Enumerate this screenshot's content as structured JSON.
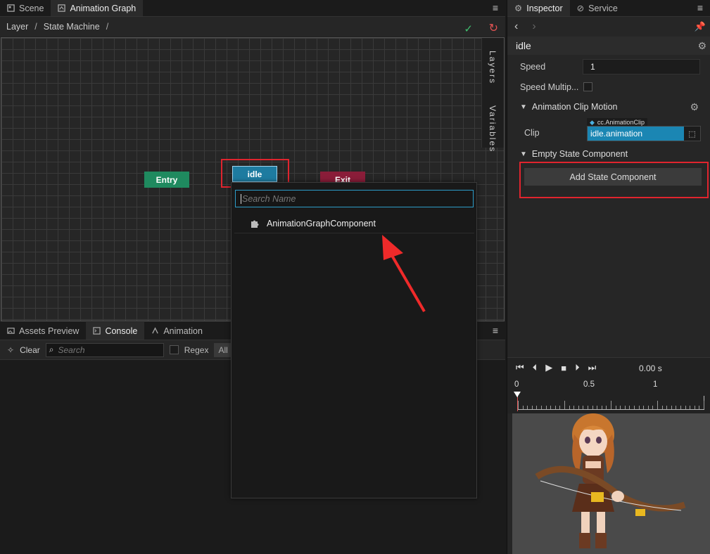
{
  "left_tabs": {
    "scene": "Scene",
    "animation_graph": "Animation Graph"
  },
  "breadcrumb": {
    "layer": "Layer",
    "state_machine": "State Machine",
    "sep": "/"
  },
  "side_strip": {
    "layers": "Layers",
    "variables": "Variables"
  },
  "nodes": {
    "entry": "Entry",
    "idle": "idle",
    "exit": "Exit"
  },
  "bottom_tabs": {
    "assets_preview": "Assets Preview",
    "console": "Console",
    "animation": "Animation"
  },
  "console_toolbar": {
    "clear": "Clear",
    "search_placeholder": "Search",
    "regex": "Regex",
    "all": "All"
  },
  "popup": {
    "search_placeholder": "Search Name",
    "items": [
      "AnimationGraphComponent"
    ]
  },
  "right_tabs": {
    "inspector": "Inspector",
    "service": "Service"
  },
  "inspector": {
    "title": "idle",
    "speed_label": "Speed",
    "speed_value": "1",
    "speed_multiplier_label": "Speed Multip...",
    "clip_motion_section": "Animation Clip Motion",
    "clip_label": "Clip",
    "clip_type": "cc.AnimationClip",
    "clip_value": "idle.animation",
    "empty_state_section": "Empty State Component",
    "add_state_button": "Add State Component"
  },
  "player": {
    "time": "0.00 s",
    "ruler": [
      "0",
      "0.5",
      "1"
    ],
    "playhead_position": 0
  },
  "colors": {
    "entry_node": "#1f8a5f",
    "idle_node": "#1e7ba0",
    "exit_node": "#8a1d39",
    "highlight": "#e0242e",
    "accent": "#2c9cc8"
  }
}
